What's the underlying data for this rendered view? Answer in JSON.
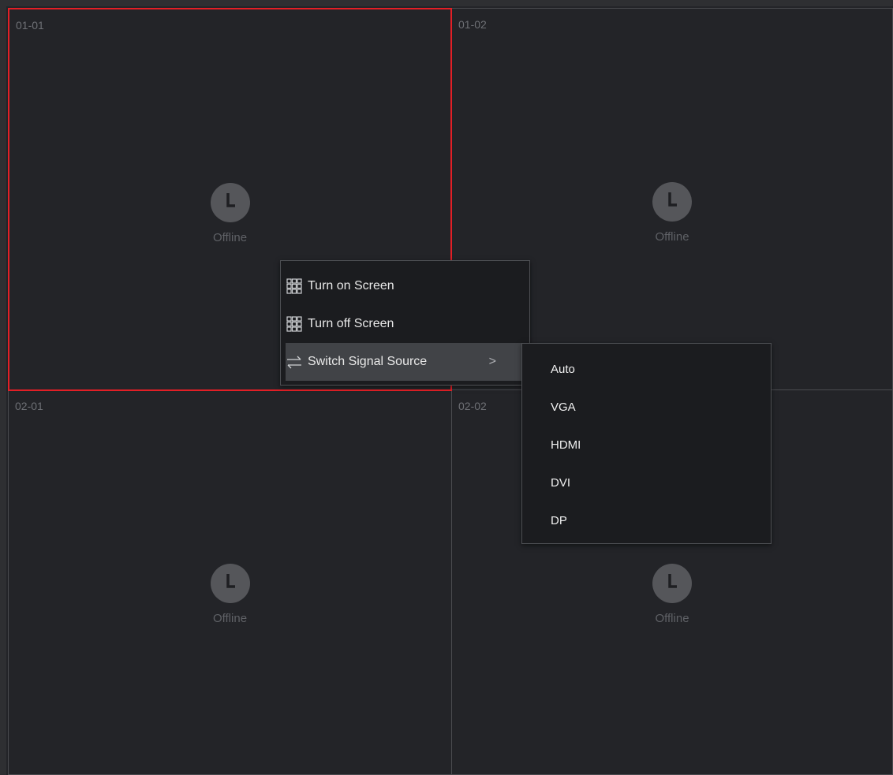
{
  "cells": [
    {
      "id": "01-01",
      "status": "Offline"
    },
    {
      "id": "01-02",
      "status": "Offline"
    },
    {
      "id": "02-01",
      "status": "Offline"
    },
    {
      "id": "02-02",
      "status": "Offline"
    }
  ],
  "selected_cell": "01-01",
  "context_menu": {
    "items": [
      {
        "label": "Turn on Screen",
        "icon": "grid-icon"
      },
      {
        "label": "Turn off Screen",
        "icon": "grid-icon"
      },
      {
        "label": "Switch Signal Source",
        "icon": "switch-arrows-icon",
        "submenu_indicator": ">"
      }
    ]
  },
  "signal_submenu": {
    "options": [
      "Auto",
      "VGA",
      "HDMI",
      "DVI",
      "DP"
    ]
  },
  "colors": {
    "selection_border": "#e21f26",
    "background": "#232428",
    "menu_bg": "#1b1c1f",
    "menu_active": "#414347"
  }
}
